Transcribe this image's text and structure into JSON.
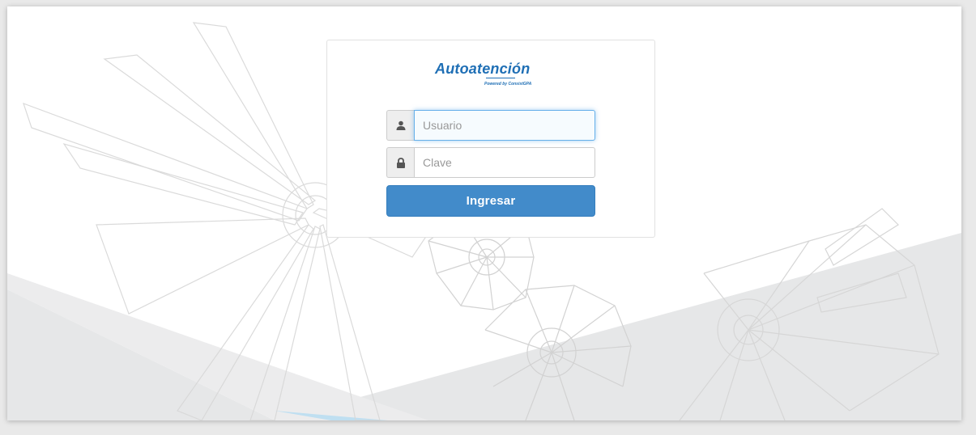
{
  "brand": {
    "title": "Autoatención",
    "powered_by": "Powered by ConsistGPA"
  },
  "login": {
    "username": {
      "value": "",
      "placeholder": "Usuario",
      "icon": "user-icon"
    },
    "password": {
      "value": "",
      "placeholder": "Clave",
      "icon": "lock-icon"
    },
    "submit_label": "Ingresar"
  },
  "colors": {
    "accent": "#428bca",
    "brand": "#1f6fb5",
    "focus": "#66afe9"
  }
}
